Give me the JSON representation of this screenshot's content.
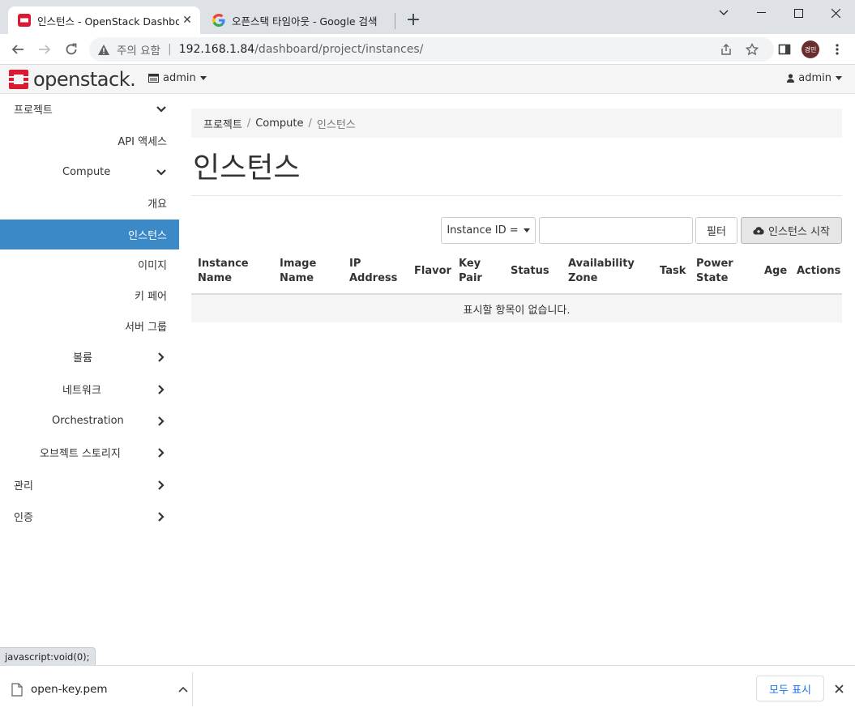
{
  "browser": {
    "tabs": [
      {
        "title": "인스턴스 - OpenStack Dashboard",
        "favicon": "openstack-favicon-icon"
      },
      {
        "title": "오픈스택 타임아웃 - Google 검색",
        "favicon": "google-favicon-icon"
      }
    ],
    "address": {
      "security_label": "주의 요함",
      "host": "192.168.1.84",
      "path": "/dashboard/project/instances/"
    },
    "profile_initials": "경민"
  },
  "header": {
    "logo_text": "openstack.",
    "project_label": "admin",
    "user_label": "admin"
  },
  "sidebar": {
    "items": [
      {
        "label": "프로젝트",
        "state": "expanded"
      },
      {
        "label": "API 액세스"
      },
      {
        "label": "Compute",
        "state": "expanded"
      },
      {
        "label": "개요"
      },
      {
        "label": "인스턴스",
        "active": true
      },
      {
        "label": "이미지"
      },
      {
        "label": "키 페어"
      },
      {
        "label": "서버 그룹"
      },
      {
        "label": "볼륨",
        "state": "collapsed"
      },
      {
        "label": "네트워크",
        "state": "collapsed"
      },
      {
        "label": "Orchestration",
        "state": "collapsed"
      },
      {
        "label": "오브젝트 스토리지",
        "state": "collapsed"
      },
      {
        "label": "관리",
        "state": "collapsed"
      },
      {
        "label": "인증",
        "state": "collapsed"
      }
    ]
  },
  "breadcrumb": {
    "items": [
      "프로젝트",
      "Compute",
      "인스턴스"
    ],
    "separator": "/"
  },
  "page": {
    "title": "인스턴스"
  },
  "filter": {
    "select_label": "Instance ID =",
    "input_value": "",
    "filter_button": "필터",
    "launch_button": "인스턴스 시작"
  },
  "table": {
    "columns": [
      [
        "Instance",
        "Name"
      ],
      [
        "Image",
        "Name"
      ],
      [
        "IP",
        "Address"
      ],
      [
        "Flavor"
      ],
      [
        "Key",
        "Pair"
      ],
      [
        "Status"
      ],
      [
        "Availability",
        "Zone"
      ],
      [
        "Task"
      ],
      [
        "Power",
        "State"
      ],
      [
        "Age"
      ],
      [
        "Actions"
      ]
    ],
    "rows": [],
    "empty_message": "표시할 항목이 없습니다."
  },
  "statusbar": {
    "text": "javascript:void(0);"
  },
  "downloads": {
    "file_name": "open-key.pem",
    "show_all": "모두 표시"
  },
  "colors": {
    "accent": "#3c89c8",
    "openstack_red": "#da1a32",
    "chrome_bg": "#dee1e6"
  }
}
